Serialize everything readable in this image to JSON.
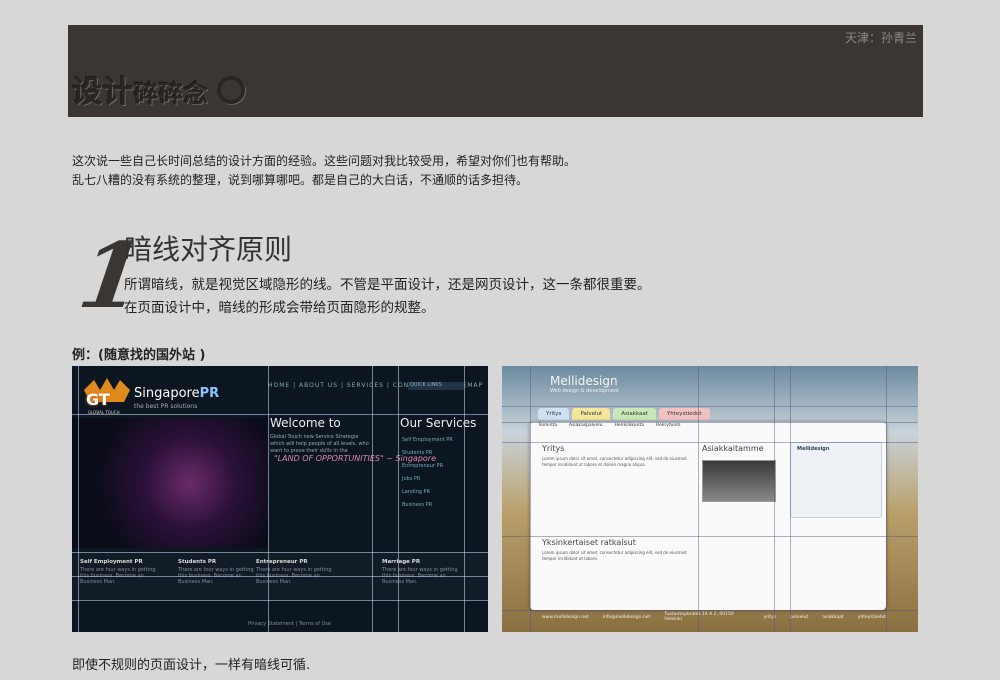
{
  "header": {
    "author": "天津：孙青兰",
    "title_big": "设计",
    "title_small": "碎碎念"
  },
  "intro": {
    "line1": "这次说一些自己长时间总结的设计方面的经验。这些问题对我比较受用，希望对你们也有帮助。",
    "line2": "乱七八糟的没有系统的整理，说到哪算哪吧。都是自己的大白话，不通顺的话多担待。"
  },
  "section": {
    "number": "1",
    "title": "暗线对齐原则",
    "desc1": "所谓暗线，就是视觉区域隐形的线。不管是平面设计，还是网页设计，这一条都很重要。",
    "desc2": "在页面设计中，暗线的形成会带给页面隐形的规整。"
  },
  "example_label": "例：(随意找的国外站 )",
  "footnote": "即使不规则的页面设计，一样有暗线可循.",
  "shot1": {
    "nav": "HOME | ABOUT US | SERVICES | CONTACT US | SITEMAP",
    "search": "QUICK LINKS",
    "logo_gt": "GT",
    "global_touch": "GLOBAL TOUCH",
    "brand": "Singapore",
    "brand_pr": "PR",
    "tagline": "the best PR solutions",
    "welcome": "Welcome to",
    "body": "Global Touch new Service Strategie which will help people of all levels, who want to prove their skills in the",
    "quote": "\"LAND OF OPPORTUNITIES\" ~ Singapore",
    "services": "Our Services",
    "services_list": [
      "Self Employment PR",
      "Students PR",
      "Entrepreneur PR",
      "Jobs PR",
      "Landing PR",
      "Business PR"
    ],
    "cols": [
      {
        "title": "Self Employment PR",
        "desc": "There are four ways in getting this business. Become an Business Man."
      },
      {
        "title": "Students PR",
        "desc": "There are four ways in getting this business. Become an Business Man."
      },
      {
        "title": "Entrepreneur PR",
        "desc": "There are four ways in getting this business. Become an Business Man."
      },
      {
        "title": "Marriage PR",
        "desc": "There are four ways in getting this business. Become an Business Man."
      }
    ],
    "footer": "Privacy Statement | Terms of Use"
  },
  "shot2": {
    "logo": "Mellidesign",
    "logo_sub": "Web design & development",
    "tabs": [
      {
        "label": "Yritys",
        "color": "#cfe0f2"
      },
      {
        "label": "Palvelut",
        "color": "#f4e79c"
      },
      {
        "label": "Asiakkaat",
        "color": "#c8e8b8"
      },
      {
        "label": "Yhteystiedot",
        "color": "#f2c2c2"
      }
    ],
    "subnav": [
      "Toiminta",
      "Asiakaspalvelu",
      "Henkilökunta",
      "Rekrytointi"
    ],
    "heading1": "Yritys",
    "heading2": "Asiakkaitamme",
    "heading3": "Yksinkertaiset ratkaisut",
    "sidebar_title": "Mellidesign",
    "footer": [
      "www.mellidesign.net",
      "info@mellidesign.net",
      "Tuotantoyksikkö 14 A 2, 00150 Helsinki",
      "yritys",
      "palvelut",
      "asiakkaat",
      "yhteystiedot"
    ]
  }
}
